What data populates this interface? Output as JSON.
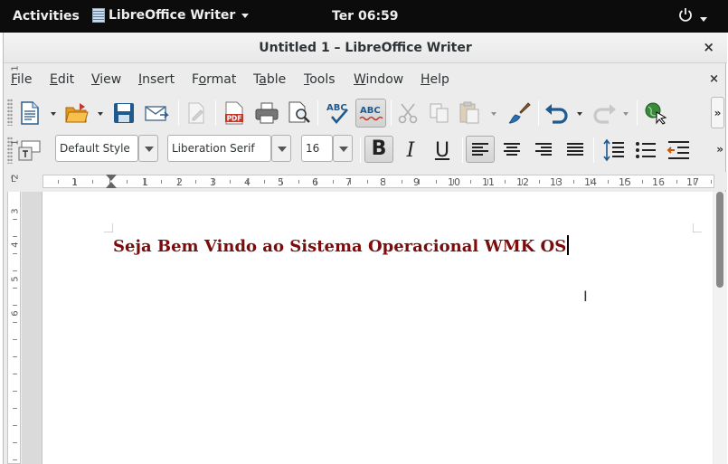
{
  "topbar": {
    "activities": "Activities",
    "app_name": "LibreOffice Writer",
    "clock": "Ter 06:59"
  },
  "window": {
    "title": "Untitled 1 – LibreOffice Writer",
    "close": "×"
  },
  "menubar": {
    "items": [
      {
        "label": "File",
        "u": "F",
        "rest": "ile"
      },
      {
        "label": "Edit",
        "u": "E",
        "rest": "dit"
      },
      {
        "label": "View",
        "u": "V",
        "rest": "iew"
      },
      {
        "label": "Insert",
        "u": "I",
        "rest": "nsert"
      },
      {
        "label": "Format",
        "pre": "F",
        "u": "o",
        "rest": "rmat"
      },
      {
        "label": "Table",
        "pre": "T",
        "u": "a",
        "rest": "ble"
      },
      {
        "label": "Tools",
        "u": "T",
        "rest": "ools"
      },
      {
        "label": "Window",
        "u": "W",
        "rest": "indow"
      },
      {
        "label": "Help",
        "u": "H",
        "rest": "elp"
      }
    ],
    "close": "×"
  },
  "formatting": {
    "paragraph_style": "Default Style",
    "font_name": "Liberation Serif",
    "font_size": "16",
    "bold_label": "B",
    "italic_label": "I",
    "underline_label": "U"
  },
  "ruler": {
    "numbers": [
      "1",
      "1",
      "2",
      "3",
      "4",
      "5",
      "6",
      "7",
      "8",
      "9",
      "10",
      "11",
      "12",
      "13",
      "14",
      "15",
      "16",
      "17"
    ],
    "vertical_numbers": [
      "1",
      "1",
      "2",
      "3",
      "4",
      "5",
      "6"
    ]
  },
  "document": {
    "text": "Seja Bem Vindo ao Sistema Operacional WMK OS",
    "text_color": "#7b0c0c"
  },
  "toolbar": {
    "overflow": "»",
    "spelling_label": "ABC",
    "autospell_label": "ABC"
  }
}
